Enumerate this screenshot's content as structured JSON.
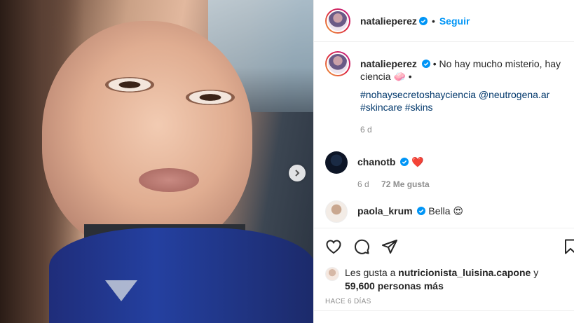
{
  "post": {
    "username": "natalieperez",
    "follow_label": "Seguir",
    "separator": "•",
    "next_icon": "chevron-right-icon"
  },
  "caption": {
    "username": "natalieperez",
    "text": "• No hay mucho misterio, hay ciencia 🧼 •",
    "tags": "#nohaysecretoshayciencia @neutrogena.ar #skincare #skins",
    "age": "6 d"
  },
  "comments": [
    {
      "username": "chanotb",
      "text": "❤️",
      "age": "6 d",
      "likes": "72 Me gusta"
    },
    {
      "username": "paola_krum",
      "text": "Bella 😍"
    }
  ],
  "actions": {
    "like_icon": "heart-icon",
    "comment_icon": "comment-icon",
    "share_icon": "paper-plane-icon",
    "save_icon": "bookmark-icon"
  },
  "likes": {
    "prefix": "Les gusta a",
    "user": "nutricionista_luisina.capone",
    "joiner": "y",
    "others": "59,600 personas más"
  },
  "timestamp": "HACE 6 DÍAS",
  "colors": {
    "link": "#0095f6",
    "verified": "#0095f6",
    "tag": "#00376b",
    "muted": "#8e8e8e"
  }
}
